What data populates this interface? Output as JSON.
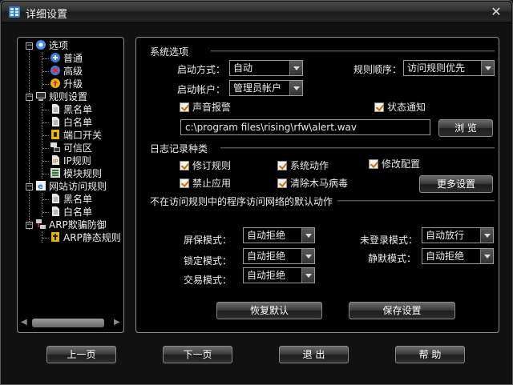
{
  "window": {
    "title": "详细设置",
    "close_glyph": "✕"
  },
  "tree": {
    "nodes": [
      {
        "label": "选项"
      },
      {
        "label": "普通"
      },
      {
        "label": "高级"
      },
      {
        "label": "升级"
      },
      {
        "label": "规则设置"
      },
      {
        "label": "黑名单"
      },
      {
        "label": "白名单"
      },
      {
        "label": "端口开关"
      },
      {
        "label": "可信区"
      },
      {
        "label": "IP规则"
      },
      {
        "label": "模块规则"
      },
      {
        "label": "网站访问规则"
      },
      {
        "label": "黑名单"
      },
      {
        "label": "白名单"
      },
      {
        "label": "ARP欺骗防御"
      },
      {
        "label": "ARP静态规则"
      }
    ],
    "expander_glyph": "−",
    "scroll_left": "◀",
    "scroll_right": "▶"
  },
  "system": {
    "title": "系统选项",
    "startup_mode_label": "启动方式：",
    "startup_mode_value": "自动",
    "rule_order_label": "规则顺序：",
    "rule_order_value": "访问规则优先",
    "startup_account_label": "启动帐户：",
    "startup_account_value": "管理员帐户",
    "sound_alarm": "声音报警",
    "status_notify": "状态通知",
    "alert_path": "c:\\program files\\rising\\rfw\\alert.wav",
    "browse": "浏 览"
  },
  "log": {
    "title": "日志记录种类",
    "items": [
      "修订规则",
      "系统动作",
      "修改配置",
      "禁止应用",
      "清除木马病毒"
    ],
    "more_settings": "更多设置"
  },
  "default_action": {
    "title": "不在访问规则中的程序访问网络的默认动作",
    "screensaver_label": "屏保模式：",
    "screensaver_value": "自动拒绝",
    "lock_label": "锁定模式：",
    "lock_value": "自动拒绝",
    "trade_label": "交易模式：",
    "trade_value": "自动拒绝",
    "notlogged_label": "未登录模式：",
    "notlogged_value": "自动放行",
    "silent_label": "静默模式：",
    "silent_value": "自动拒绝",
    "restore_default": "恢复默认",
    "save_settings": "保存设置"
  },
  "footer": {
    "prev": "上一页",
    "next": "下一页",
    "exit": "退 出",
    "help": "帮 助"
  },
  "colors": {
    "check_mark": "#c87000",
    "accent_blue": "#2f7fd8"
  }
}
